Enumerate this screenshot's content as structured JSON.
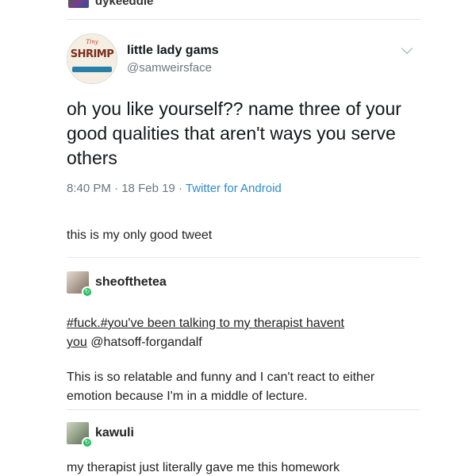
{
  "top_user": {
    "name": "dykeeddie"
  },
  "tweet": {
    "avatar_text": {
      "top": "Tiny",
      "main": "SHRIMP"
    },
    "display_name": "little lady gams",
    "handle": "@samweirsface",
    "text": "oh you like yourself?? name three of your good qualities that aren't ways you serve others",
    "time": "8:40 PM",
    "separator1": "·",
    "date": "18 Feb 19",
    "separator2": "·",
    "source": "Twitter for Android"
  },
  "caption": "this is my only good tweet",
  "reblogs": [
    {
      "name": "sheofthetea",
      "tags_line1": "#fuck.#you've been talking to my therapist havent",
      "tags_line2_tag": "you",
      "tags_line2_mention": " @hatsoff-forgandalf",
      "body": "This is so relatable and funny and I can't react to either emotion because I'm in a middle of lecture."
    },
    {
      "name": "kawuli",
      "body": "my therapist just literally gave me this homework"
    }
  ],
  "colors": {
    "link": "#2a8cd0",
    "muted": "#6b7780",
    "reblog_badge": "#1fbf62"
  },
  "icons": {
    "reblog": "reblog-icon",
    "chevron": "chevron-down-icon"
  }
}
